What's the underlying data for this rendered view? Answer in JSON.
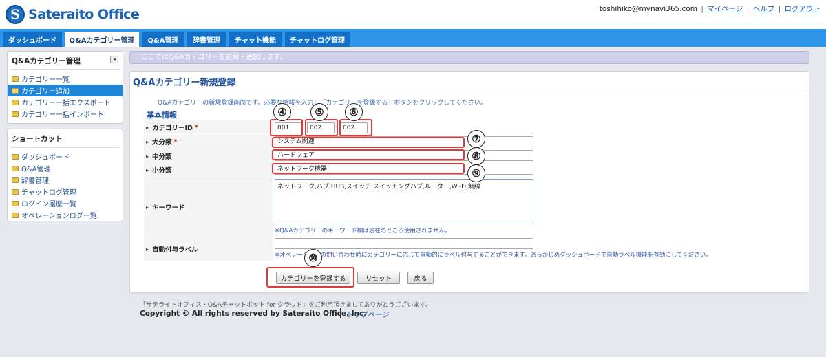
{
  "header": {
    "logo_mark": "S",
    "logo_text": "Sateraito Office",
    "user_email": "toshihiko@mynavi365.com",
    "links": [
      "マイページ",
      "ヘルプ",
      "ログアウト"
    ]
  },
  "nav": {
    "tabs": [
      "ダッシュボード",
      "Q&Aカテゴリー管理",
      "Q&A管理",
      "辞書管理",
      "チャット機能",
      "チャットログ管理"
    ],
    "active_index": 1
  },
  "sidebar": {
    "panel1_title": "Q&Aカテゴリー管理",
    "collapse_glyph": "◂",
    "panel1_items": [
      "カテゴリー一覧",
      "カテゴリー追加",
      "カテゴリー一括エクスポート",
      "カテゴリー一括インポート"
    ],
    "panel1_active_index": 1,
    "panel2_title": "ショートカット",
    "panel2_items": [
      "ダッシュボード",
      "Q&A管理",
      "辞書管理",
      "チャットログ管理",
      "ログイン履歴一覧",
      "オペレーションログ一覧"
    ]
  },
  "main": {
    "info": "ここではQ&Aカテゴリーを更新・追加します。",
    "title": "Q&Aカテゴリー新規登録",
    "description": "Q&Aカテゴリーの新規登録画面です。必要な情報を入力し「カテゴリーを登録する」ボタンをクリックしてください。",
    "section": "基本情報",
    "labels": {
      "category_id": "カテゴリーID",
      "major": "大分類",
      "middle": "中分類",
      "minor": "小分類",
      "keyword": "キーワード",
      "auto_label": "自動付与ラベル"
    },
    "required_mark": "*",
    "values": {
      "id1": "001",
      "id2": "002",
      "id3": "002",
      "id_dash": "-",
      "major": "システム関連",
      "middle": "ハードウェア",
      "minor": "ネットワーク機器",
      "keyword": "ネットワーク,ハブ,HUB,スイッチ,スイッチングハブ,ルーター,Wi-Fi,無線",
      "auto_label": ""
    },
    "keyword_note": "※Q&Aカテゴリーのキーワード欄は現在のところ使用されません。",
    "auto_label_note": "※オペレーターへの問い合わせ時にカテゴリーに応じて自動的にラベル付与することができます。あらかじめダッシュボードで自動ラベル機能を有効にしてください。",
    "buttons": {
      "register": "カテゴリーを登録する",
      "reset": "リセット",
      "back": "戻る"
    }
  },
  "annotations": {
    "n4": "④",
    "n5": "⑤",
    "n6": "⑥",
    "n7": "⑦",
    "n8": "⑧",
    "n9": "⑨",
    "n10": "⑩",
    "highlight_color": "#e03a3a"
  },
  "footer": {
    "thanks": "「サテライトオフィス・Q&Aチャットボット for クラウド」をご利用頂きましてありがとうございます。",
    "copyright": "Copyright © All rights reserved by Sateraito Office, Inc.",
    "top_link": "トップページ"
  },
  "colors": {
    "nav_bar": "#2e96e8",
    "tab": "#1370c8",
    "title_blue": "#1d4f9a",
    "sidebar_active": "#1f86d9"
  }
}
